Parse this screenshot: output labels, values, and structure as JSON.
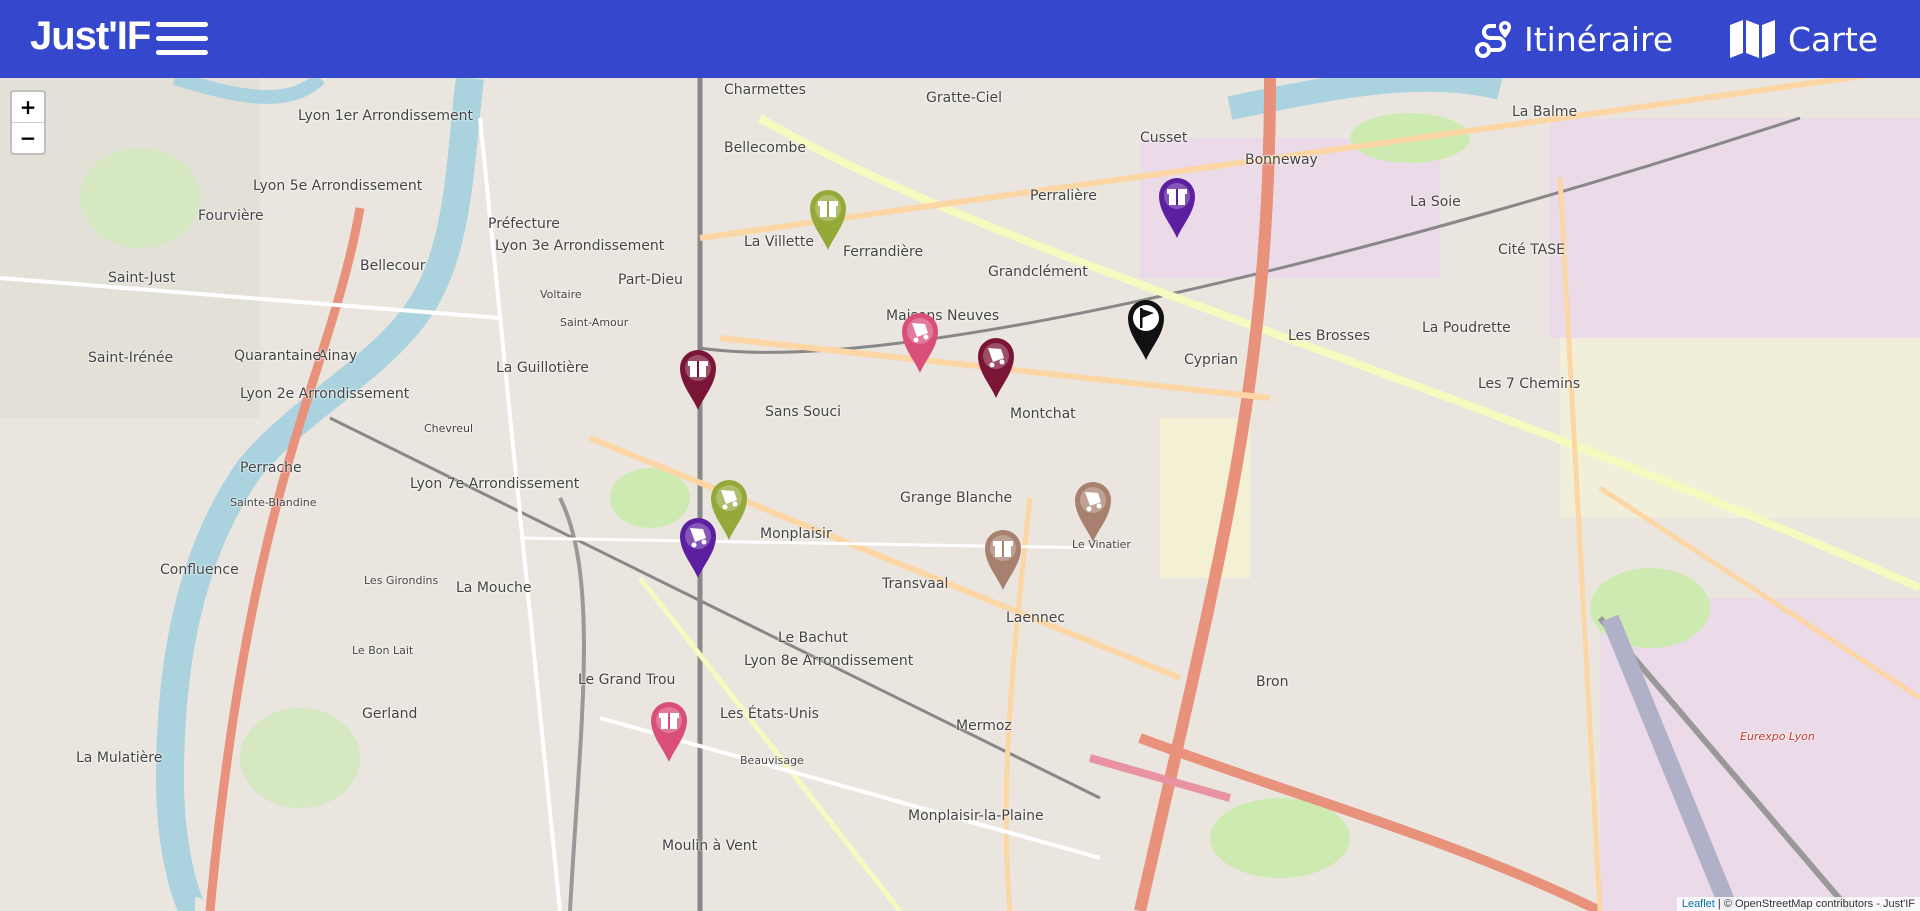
{
  "header": {
    "brand": "Just'IF",
    "nav": [
      {
        "label": "Itinéraire",
        "icon": "route-icon"
      },
      {
        "label": "Carte",
        "icon": "map-icon"
      }
    ],
    "color": "#3547cc"
  },
  "map": {
    "zoom_in": "+",
    "zoom_out": "−",
    "attribution_link": "Leaflet",
    "attribution_text": " | © OpenStreetMap contributors - Just'IF",
    "labels": [
      "Lyon 1er Arrondissement",
      "Lyon 5e Arrondissement",
      "Fourvière",
      "Saint-Just",
      "Lyon 3e Arrondissement",
      "Part-Dieu",
      "Préfecture",
      "Bellecour",
      "Ainay",
      "Lyon 2e Arrondissement",
      "Perrache",
      "Confluence",
      "Lyon 7e Arrondissement",
      "La Guillotière",
      "Sans Souci",
      "Monplaisir",
      "Grange Blanche",
      "Montchat",
      "La Villette",
      "Ferrandière",
      "Grandclément",
      "Cusset",
      "Bonneway",
      "La Soie",
      "Cité TASE",
      "Les Brosses",
      "La Poudrette",
      "Les 7 Chemins",
      "Cyprian",
      "Le Vinatier",
      "Laennec",
      "Transvaal",
      "Le Bachut",
      "Lyon 8e Arrondissement",
      "Les États-Unis",
      "Mermoz",
      "Monplaisir-la-Plaine",
      "Bron",
      "Moulin à Vent",
      "Gerland",
      "La Mulatière",
      "Saint-Irénée",
      "Quarantaine",
      "Charmettes",
      "Gratte-Ciel",
      "Perralière",
      "Bellecombe",
      "La Balme",
      "Maisons Neuves",
      "Voltaire",
      "Saint-Amour",
      "Le Grand Trou",
      "La Mouche",
      "Les Girondins",
      "Le Bon Lait",
      "Eurexpo Lyon",
      "Beauvisage",
      "Sainte-Blandine",
      "Chevreul"
    ]
  },
  "markers": [
    {
      "type": "gift",
      "color": "#94a93a"
    },
    {
      "type": "gift",
      "color": "#5b1f9f"
    },
    {
      "type": "cart",
      "color": "#d94f7a"
    },
    {
      "type": "flag",
      "color": "#111111"
    },
    {
      "type": "cart",
      "color": "#7a1535"
    },
    {
      "type": "gift",
      "color": "#7a1535"
    },
    {
      "type": "cart",
      "color": "#a88070"
    },
    {
      "type": "cart",
      "color": "#94a93a"
    },
    {
      "type": "cart",
      "color": "#5b1f9f"
    },
    {
      "type": "gift",
      "color": "#a88070"
    },
    {
      "type": "gift",
      "color": "#d94f7a"
    }
  ]
}
